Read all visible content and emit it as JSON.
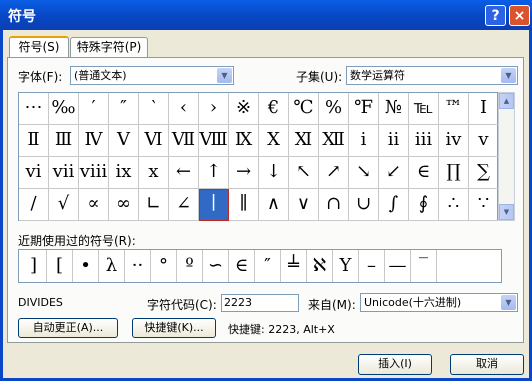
{
  "window": {
    "title": "符号",
    "help_label": "?",
    "close_label": "×"
  },
  "tabs": [
    "符号(S)",
    "特殊字符(P)"
  ],
  "font": {
    "label": "字体(F):",
    "value": "(普通文本)"
  },
  "subset": {
    "label": "子集(U):",
    "value": "数学运算符"
  },
  "symbols": [
    [
      "⋯",
      "‰",
      "′",
      "″",
      "‵",
      "‹",
      "›",
      "※",
      "€",
      "℃",
      "%",
      "℉",
      "№",
      "℡",
      "™",
      "Ⅰ"
    ],
    [
      "Ⅱ",
      "Ⅲ",
      "Ⅳ",
      "Ⅴ",
      "Ⅵ",
      "Ⅶ",
      "Ⅷ",
      "Ⅸ",
      "Ⅹ",
      "Ⅺ",
      "Ⅻ",
      "ⅰ",
      "ⅱ",
      "ⅲ",
      "ⅳ",
      "ⅴ"
    ],
    [
      "ⅵ",
      "ⅶ",
      "ⅷ",
      "ⅸ",
      "ⅹ",
      "←",
      "↑",
      "→",
      "↓",
      "↖",
      "↗",
      "↘",
      "↙",
      "∈",
      "∏",
      "∑"
    ],
    [
      "∕",
      "√",
      "∝",
      "∞",
      "∟",
      "∠",
      "∣",
      "∥",
      "∧",
      "∨",
      "∩",
      "∪",
      "∫",
      "∮",
      "∴",
      "∵"
    ]
  ],
  "selected_cell": {
    "row": 3,
    "col": 6
  },
  "recent": {
    "label": "近期使用过的符号(R):",
    "symbols": [
      "]",
      "[",
      "•",
      "λ",
      "··",
      "°",
      "º",
      "∽",
      "∈",
      "″",
      "╧",
      "ℵ",
      "Y",
      "–",
      "—",
      "‾"
    ]
  },
  "char_name": "DIVIDES",
  "char_code": {
    "label": "字符代码(C):",
    "value": "2223"
  },
  "from": {
    "label": "来自(M):",
    "value": "Unicode(十六进制)"
  },
  "buttons": {
    "autocorrect": "自动更正(A)...",
    "shortcut_key": "快捷键(K)...",
    "insert": "插入(I)",
    "cancel": "取消"
  },
  "shortcut_text": "快捷键: 2223, Alt+X"
}
